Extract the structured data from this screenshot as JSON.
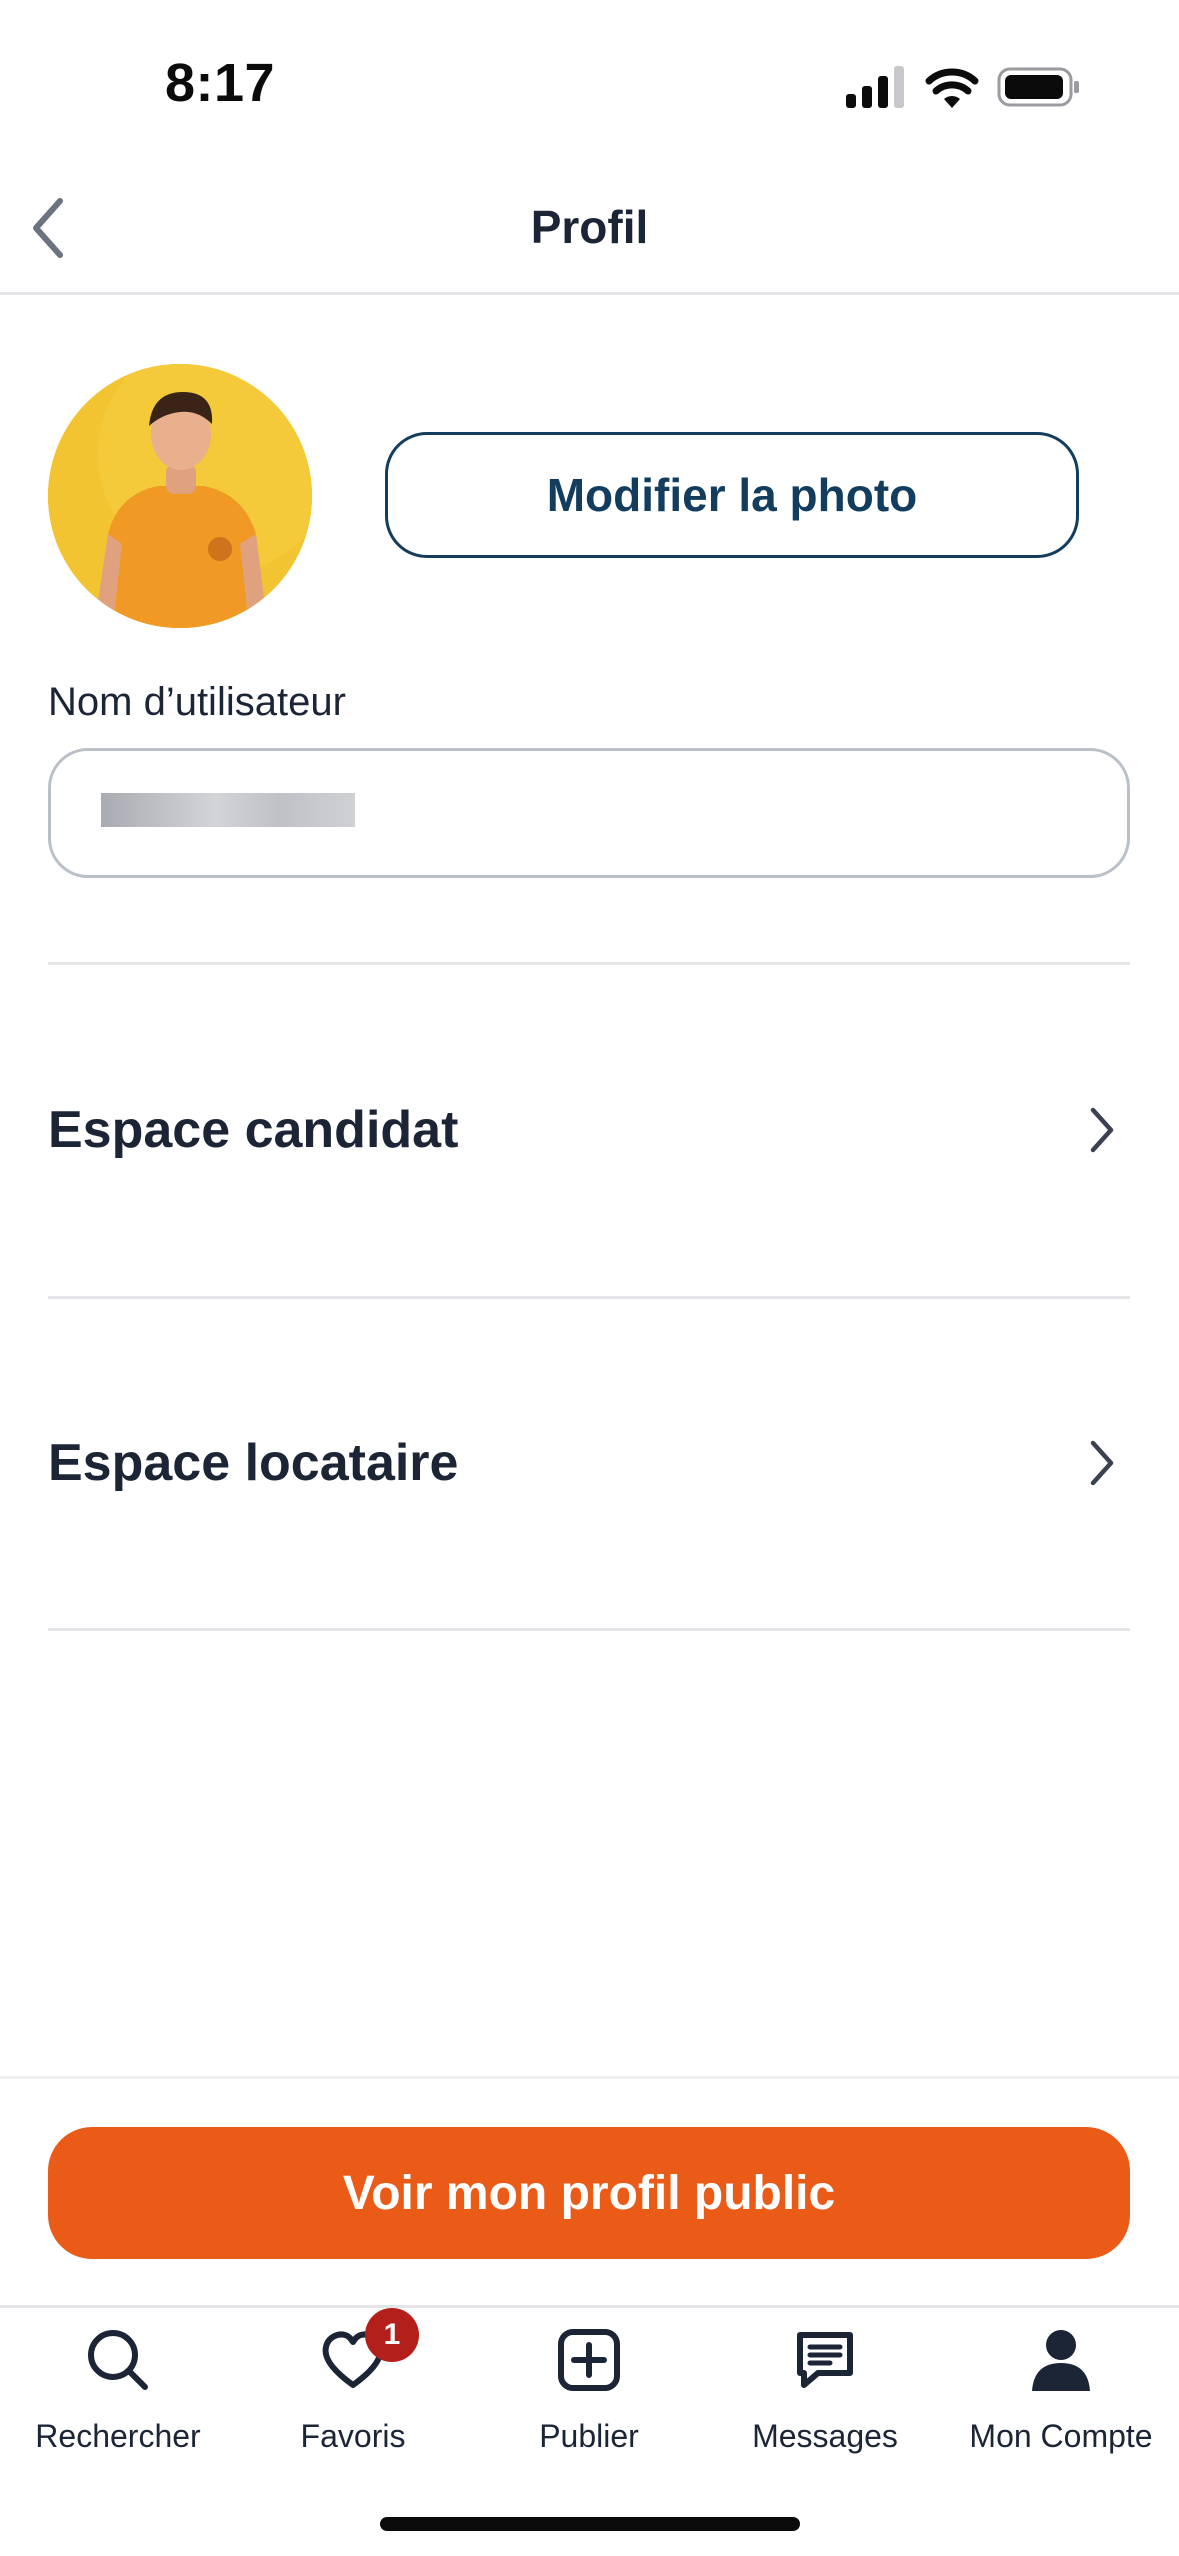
{
  "status_bar": {
    "time": "8:17"
  },
  "header": {
    "title": "Profil"
  },
  "profile": {
    "change_photo_label": "Modifier la photo",
    "username_label": "Nom d’utilisateur",
    "username_value": ""
  },
  "menu": {
    "items": [
      {
        "label": "Espace candidat"
      },
      {
        "label": "Espace locataire"
      }
    ]
  },
  "cta": {
    "label": "Voir mon profil public"
  },
  "tabbar": {
    "tabs": [
      {
        "label": "Rechercher",
        "icon": "search-icon"
      },
      {
        "label": "Favoris",
        "icon": "heart-icon",
        "badge": "1"
      },
      {
        "label": "Publier",
        "icon": "plus-square-icon"
      },
      {
        "label": "Messages",
        "icon": "message-icon"
      },
      {
        "label": "Mon Compte",
        "icon": "user-icon"
      }
    ]
  },
  "colors": {
    "primary_navy": "#123d5e",
    "accent_orange": "#ea5b17",
    "badge_red": "#b3201c",
    "text_dark": "#1b2536"
  }
}
